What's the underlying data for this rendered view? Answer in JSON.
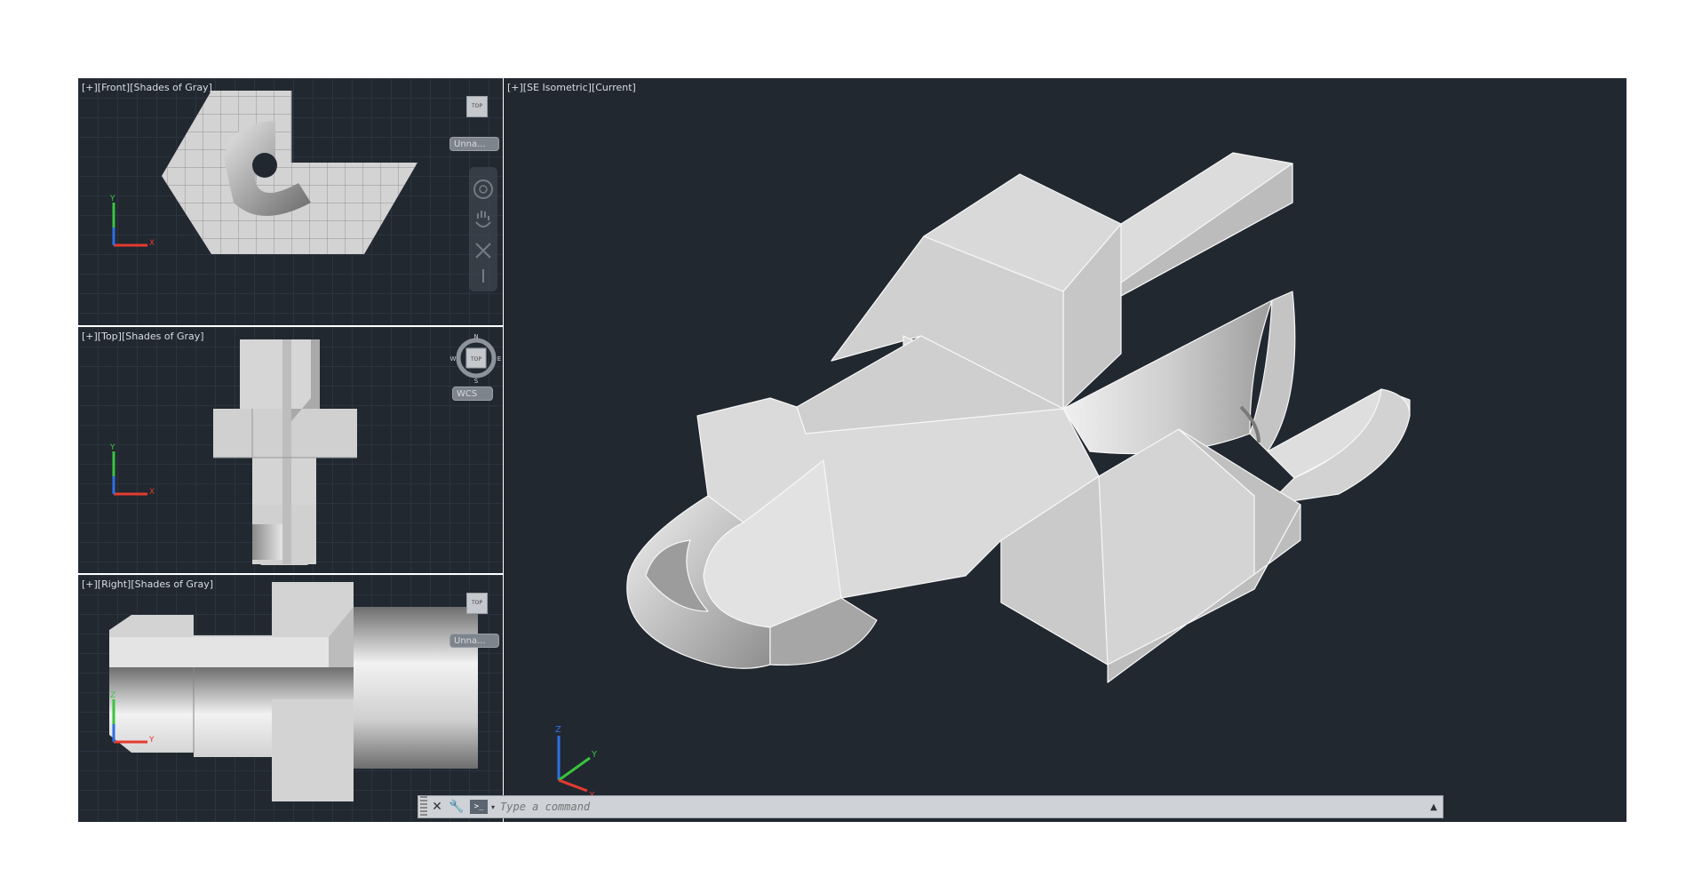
{
  "viewports": {
    "front": {
      "label": "[+][Front][Shades of Gray]",
      "named_view": "Unna..."
    },
    "top": {
      "label": "[+][Top][Shades of Gray]",
      "named_view": "WCS",
      "compass": {
        "n": "N",
        "s": "S",
        "e": "E",
        "w": "W"
      }
    },
    "right": {
      "label": "[+][Right][Shades of Gray]",
      "named_view": "Unna..."
    },
    "iso": {
      "label": "[+][SE Isometric][Current]"
    }
  },
  "viewcube_face": "TOP",
  "ucs_axes": {
    "x": "X",
    "y": "Y",
    "z": "Z"
  },
  "command_line": {
    "placeholder": "Type a command",
    "prompt_symbol": ">_"
  },
  "icons": [
    "close-icon",
    "wrench-icon",
    "command-prompt-icon",
    "pan-icon",
    "orbit-icon",
    "zoom-extents-icon",
    "steering-wheel-icon"
  ],
  "colors": {
    "viewport_bg": "#212830",
    "axis_x": "#e53a2f",
    "axis_y": "#39c53d",
    "axis_z": "#2f6ee5",
    "model": "#cfcfcf"
  }
}
